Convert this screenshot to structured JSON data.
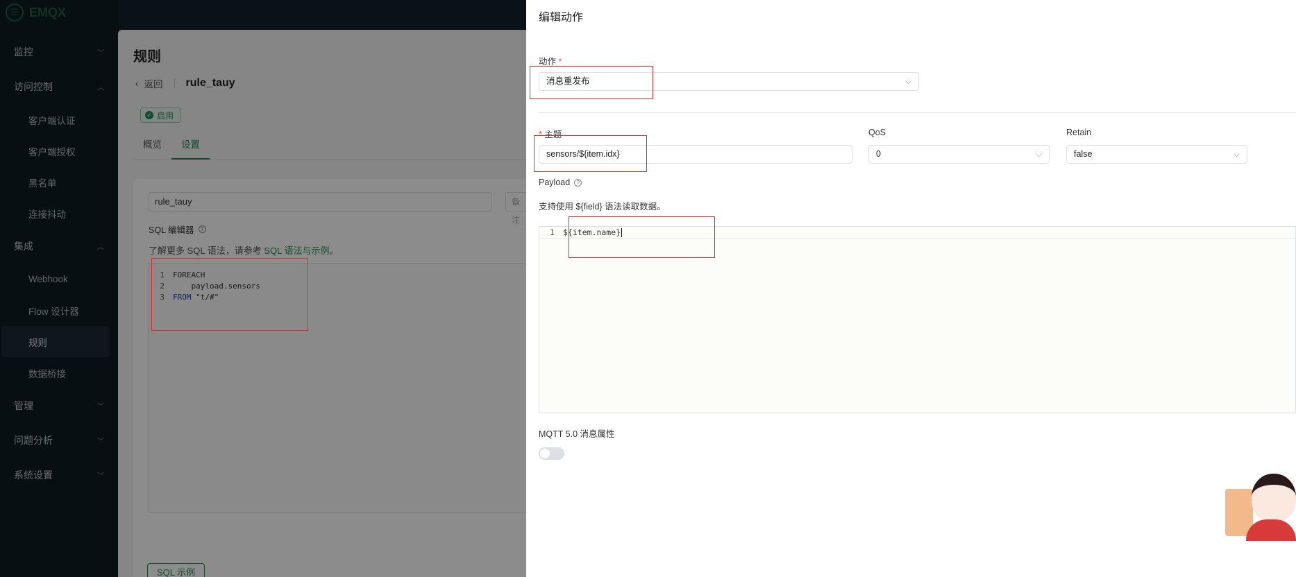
{
  "app": {
    "logo_text": "EMQX"
  },
  "sidebar": {
    "groups": [
      {
        "label": "监控"
      },
      {
        "label": "访问控制",
        "items": [
          "客户端认证",
          "客户端授权",
          "黑名单",
          "连接抖动"
        ]
      },
      {
        "label": "集成",
        "items": [
          "Webhook",
          "Flow 设计器",
          "规则",
          "数据桥接"
        ]
      },
      {
        "label": "管理"
      },
      {
        "label": "问题分析"
      },
      {
        "label": "系统设置"
      }
    ],
    "active_item": "规则"
  },
  "page": {
    "title": "规则",
    "back_label": "返回",
    "rule_name": "rule_tauy",
    "status": "启用",
    "tabs": [
      "概览",
      "设置"
    ],
    "active_tab": "设置",
    "rule_input_value": "rule_tauy",
    "note_placeholder": "备注",
    "sql_label": "SQL 编辑器",
    "sql_tip_prefix": "了解更多 SQL 语法，请参考",
    "sql_tip_link": "SQL 语法与示例",
    "sql_tip_suffix": "。",
    "sql_lines": [
      {
        "num": "1",
        "text": "FOREACH"
      },
      {
        "num": "2",
        "text": "    payload.sensors"
      },
      {
        "num": "3",
        "kw": "FROM",
        "text": " \"t/#\""
      }
    ],
    "sql_example_button": "SQL 示例"
  },
  "drawer": {
    "title": "编辑动作",
    "action_label": "动作",
    "action_value": "消息重发布",
    "topic_label": "主题",
    "topic_value": "sensors/${item.idx}",
    "qos_label": "QoS",
    "qos_value": "0",
    "retain_label": "Retain",
    "retain_value": "false",
    "payload_label": "Payload",
    "payload_tip": "支持使用 ${field} 语法读取数据。",
    "payload_line_num": "1",
    "payload_code": "${item.name}",
    "mqtt_label": "MQTT 5.0 消息属性",
    "mqtt_enabled": false
  },
  "colors": {
    "brand": "#1f8a55",
    "highlight": "#e12a2a",
    "sidebar_bg": "#0f1c22"
  }
}
